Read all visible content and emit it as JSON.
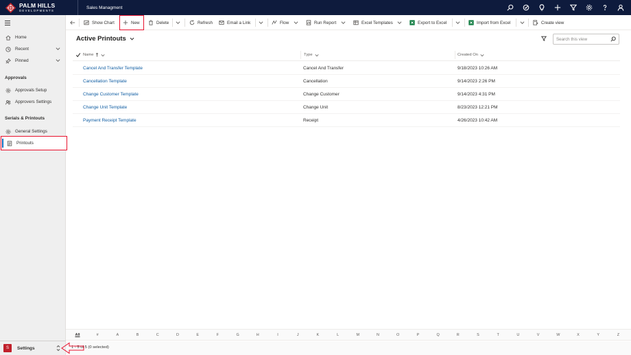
{
  "topbar": {
    "logo_line1": "PALM HILLS",
    "logo_line2": "DEVELOPMENTS",
    "app_title": "Sales Managment",
    "icons": [
      "search-icon",
      "target-icon",
      "lightbulb-icon",
      "plus-icon",
      "filter-icon",
      "gear-icon",
      "help-icon",
      "person-icon"
    ]
  },
  "sidebar": {
    "items": [
      {
        "label": "Home",
        "icon": "home-icon"
      },
      {
        "label": "Recent",
        "icon": "clock-icon"
      },
      {
        "label": "Pinned",
        "icon": "pin-icon"
      }
    ],
    "groups": [
      {
        "title": "Approvals",
        "items": [
          {
            "label": "Approvals Setup",
            "icon": "gear-icon"
          },
          {
            "label": "Approvers Settings",
            "icon": "people-icon"
          }
        ]
      },
      {
        "title": "Serials & Printouts",
        "items": [
          {
            "label": "General Settings",
            "icon": "gear-icon"
          },
          {
            "label": "Printouts",
            "icon": "list-icon"
          }
        ]
      }
    ],
    "area": {
      "badge": "S",
      "label": "Settings"
    }
  },
  "commandbar": {
    "show_chart": "Show Chart",
    "new": "New",
    "delete": "Delete",
    "refresh": "Refresh",
    "email_link": "Email a Link",
    "flow": "Flow",
    "run_report": "Run Report",
    "excel_templates": "Excel Templates",
    "export_excel": "Export to Excel",
    "import_excel": "Import from Excel",
    "create_view": "Create view"
  },
  "view": {
    "title": "Active Printouts",
    "search_placeholder": "Search this view"
  },
  "grid": {
    "columns": [
      "Name",
      "Type",
      "Created On"
    ],
    "rows": [
      {
        "name": "Cancel And Transfer Template",
        "type": "Cancel And Transfer",
        "created": "9/18/2023 10:26 AM"
      },
      {
        "name": "Cancellation Template",
        "type": "Cancellation",
        "created": "9/14/2023 2:26 PM"
      },
      {
        "name": "Change Customer Template",
        "type": "Change Customer",
        "created": "9/14/2023 4:31 PM"
      },
      {
        "name": "Change Unit Template",
        "type": "Change Unit",
        "created": "8/23/2023 12:21 PM"
      },
      {
        "name": "Payment Receipt Template",
        "type": "Receipt",
        "created": "4/26/2023 10:42 AM"
      }
    ]
  },
  "jumpbar": [
    "All",
    "#",
    "A",
    "B",
    "C",
    "D",
    "E",
    "F",
    "G",
    "H",
    "I",
    "J",
    "K",
    "L",
    "M",
    "N",
    "O",
    "P",
    "Q",
    "R",
    "S",
    "T",
    "U",
    "V",
    "W",
    "X",
    "Y",
    "Z"
  ],
  "footer": {
    "record_count": "1 - 5 of 5 (0 selected)"
  },
  "colors": {
    "topbar": "#0e1b3d",
    "highlight": "#e8112d",
    "link": "#115ea3",
    "area_badge": "#c0202b"
  }
}
